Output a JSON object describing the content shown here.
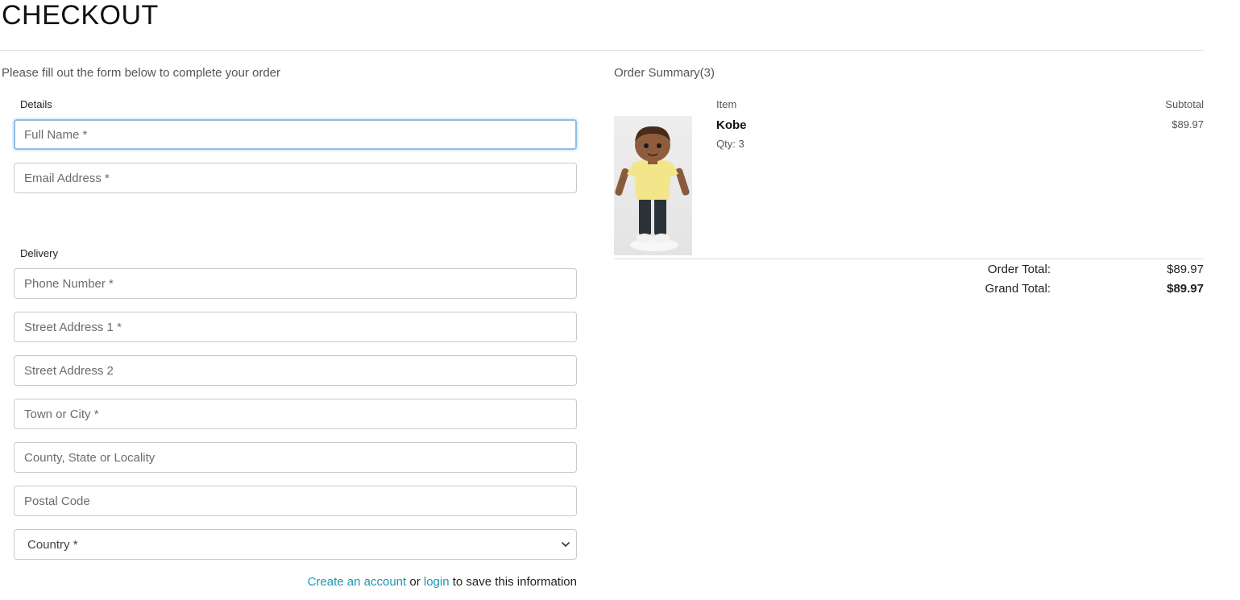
{
  "page": {
    "title": "CHECKOUT",
    "intro": "Please fill out the form below to complete your order"
  },
  "form": {
    "details_label": "Details",
    "delivery_label": "Delivery",
    "fields": {
      "full_name": {
        "placeholder": "Full Name *",
        "value": ""
      },
      "email": {
        "placeholder": "Email Address *",
        "value": ""
      },
      "phone": {
        "placeholder": "Phone Number *",
        "value": ""
      },
      "street1": {
        "placeholder": "Street Address 1 *",
        "value": ""
      },
      "street2": {
        "placeholder": "Street Address 2",
        "value": ""
      },
      "town": {
        "placeholder": "Town or City *",
        "value": ""
      },
      "county": {
        "placeholder": "County, State or Locality",
        "value": ""
      },
      "postcode": {
        "placeholder": "Postal Code",
        "value": ""
      }
    },
    "country": {
      "selected": "Country *"
    },
    "account": {
      "create_link": "Create an account",
      "or_text": "or",
      "login_link": "login",
      "suffix": "to save this information"
    }
  },
  "summary": {
    "title": "Order Summary(3)",
    "col_item": "Item",
    "col_subtotal": "Subtotal",
    "items": [
      {
        "name": "Kobe",
        "qty": "Qty: 3",
        "subtotal": "$89.97"
      }
    ],
    "order_total_label": "Order Total:",
    "order_total_value": "$89.97",
    "grand_total_label": "Grand Total:",
    "grand_total_value": "$89.97"
  },
  "colors": {
    "link": "#1a98b5",
    "focus_border": "#8fbde8",
    "field_border": "#c9c9c9"
  },
  "icons": {
    "select": "chevron-down-icon"
  }
}
